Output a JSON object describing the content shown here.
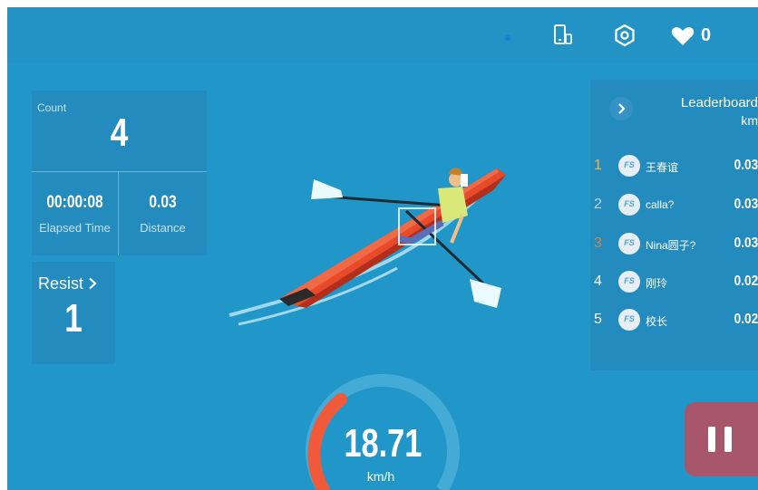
{
  "topbar": {
    "icons": [
      "bluetooth-dot",
      "phone-mirror-icon",
      "settings-icon",
      "heart-icon"
    ],
    "like_count": "0"
  },
  "stats": {
    "count_label": "Count",
    "count_value": "4",
    "elapsed_value": "00:00:08",
    "elapsed_label": "Elapsed Time",
    "distance_value": "0.03",
    "distance_label": "Distance"
  },
  "resist": {
    "label": "Resist",
    "value": "1"
  },
  "leaderboard": {
    "title": "Leaderboard",
    "unit": "km",
    "rows": [
      {
        "rank": "1",
        "avatar": "FS",
        "name": "王春谊",
        "value": "0.03",
        "rank_color": "#f5b53d"
      },
      {
        "rank": "2",
        "avatar": "FS",
        "name": "calla?",
        "value": "0.03",
        "rank_color": "#b8d4e6"
      },
      {
        "rank": "3",
        "avatar": "FS",
        "name": "Nina圆子?",
        "value": "0.03",
        "rank_color": "#c98a4a"
      },
      {
        "rank": "4",
        "avatar": "FS",
        "name": "刚玲",
        "value": "0.02",
        "rank_color": "#ffffff"
      },
      {
        "rank": "5",
        "avatar": "FS",
        "name": "校长",
        "value": "0.02",
        "rank_color": "#ffffff"
      }
    ]
  },
  "speed": {
    "value": "18.71",
    "unit": "km/h",
    "gauge_fraction": 0.28
  },
  "colors": {
    "background": "#2196c8",
    "pause_button": "#a8566b",
    "gauge_active": "#f05a3a"
  }
}
